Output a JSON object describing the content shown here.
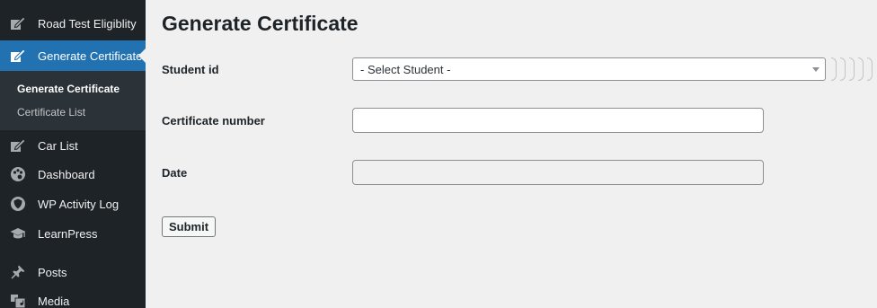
{
  "sidebar": {
    "items": [
      {
        "label": "Road Test Eligiblity",
        "icon": "edit-icon"
      },
      {
        "label": "Generate Certificate",
        "icon": "edit-icon"
      },
      {
        "label": "Car List",
        "icon": "edit-icon"
      },
      {
        "label": "Dashboard",
        "icon": "palette-icon"
      },
      {
        "label": "WP Activity Log",
        "icon": "shield-icon"
      },
      {
        "label": "LearnPress",
        "icon": "graduation-cap-icon"
      },
      {
        "label": "Posts",
        "icon": "pin-icon"
      },
      {
        "label": "Media",
        "icon": "media-icon"
      }
    ],
    "submenu": [
      {
        "label": "Generate Certificate"
      },
      {
        "label": "Certificate List"
      }
    ]
  },
  "main": {
    "title": "Generate Certificate",
    "fields": {
      "student_label": "Student id",
      "student_select_value": "- Select Student -",
      "certificate_label": "Certificate number",
      "certificate_value": "",
      "date_label": "Date",
      "date_value": ""
    },
    "submit_label": "Submit"
  },
  "colors": {
    "sidebar_bg": "#1d2327",
    "submenu_bg": "#2c3338",
    "accent": "#2271b1",
    "page_bg": "#f0f0f1"
  }
}
